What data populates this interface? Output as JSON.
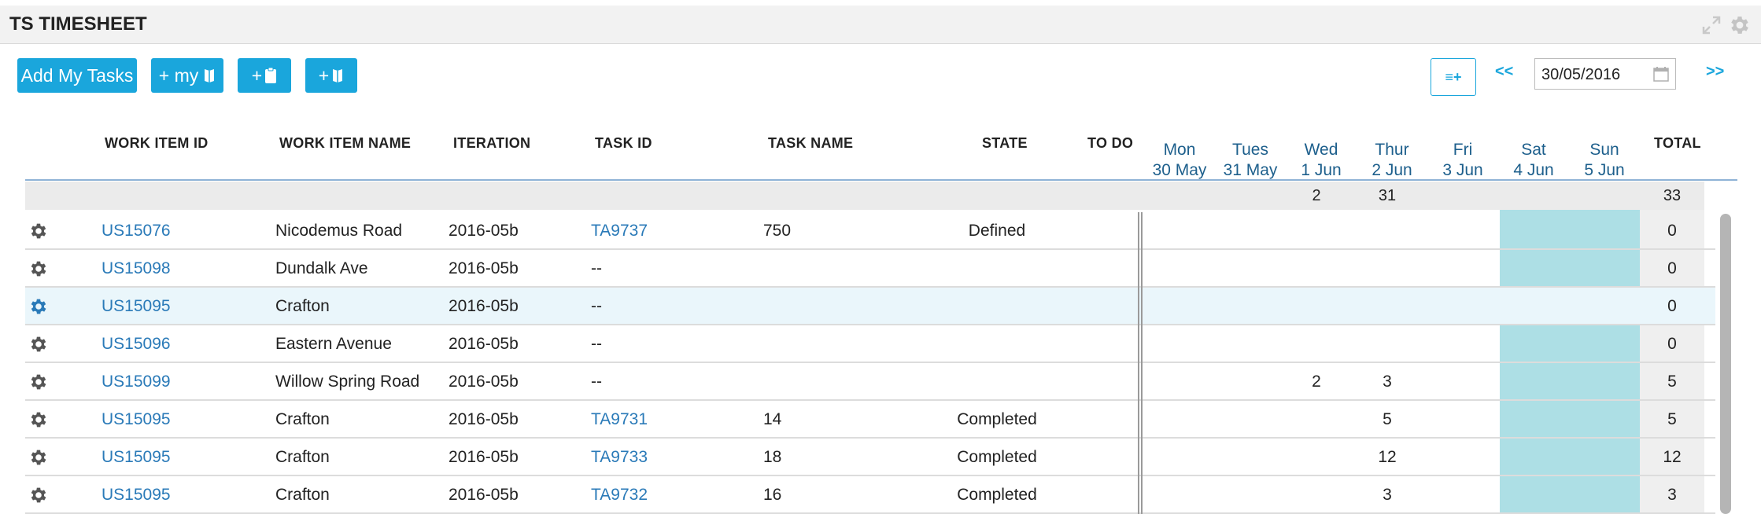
{
  "panel": {
    "title": "TS TIMESHEET",
    "expand_icon": "expand-icon",
    "settings_icon": "gear-icon"
  },
  "toolbar": {
    "add_my_tasks": "Add My Tasks",
    "add_my_stories": "+ my",
    "add_task_icon": "+",
    "add_story_icon": "+",
    "view_toggle": "≡+",
    "prev": "<<",
    "next": ">>",
    "date": "30/05/2016"
  },
  "columns": {
    "work_item_id": "WORK ITEM ID",
    "work_item_name": "WORK ITEM NAME",
    "iteration": "ITERATION",
    "task_id": "TASK ID",
    "task_name": "TASK NAME",
    "state": "STATE",
    "todo": "TO DO",
    "total": "TOTAL"
  },
  "days": [
    {
      "day": "Mon",
      "date": "30 May"
    },
    {
      "day": "Tues",
      "date": "31 May"
    },
    {
      "day": "Wed",
      "date": "1 Jun"
    },
    {
      "day": "Thur",
      "date": "2 Jun"
    },
    {
      "day": "Fri",
      "date": "3 Jun"
    },
    {
      "day": "Sat",
      "date": "4 Jun"
    },
    {
      "day": "Sun",
      "date": "5 Jun"
    }
  ],
  "summary": {
    "wed": "2",
    "thur": "31",
    "total": "33"
  },
  "rows": [
    {
      "work_item_id": "US15076",
      "work_item_name": "Nicodemus Road",
      "iteration": "2016-05b",
      "task_id": "TA9737",
      "task_name": "750",
      "state": "Defined",
      "wed": "",
      "thur": "",
      "total": "0"
    },
    {
      "work_item_id": "US15098",
      "work_item_name": "Dundalk Ave",
      "iteration": "2016-05b",
      "task_id": "--",
      "task_name": "",
      "state": "",
      "wed": "",
      "thur": "",
      "total": "0"
    },
    {
      "work_item_id": "US15095",
      "work_item_name": "Crafton",
      "iteration": "2016-05b",
      "task_id": "--",
      "task_name": "",
      "state": "",
      "wed": "",
      "thur": "",
      "total": "0"
    },
    {
      "work_item_id": "US15096",
      "work_item_name": "Eastern Avenue",
      "iteration": "2016-05b",
      "task_id": "--",
      "task_name": "",
      "state": "",
      "wed": "",
      "thur": "",
      "total": "0"
    },
    {
      "work_item_id": "US15099",
      "work_item_name": "Willow Spring Road",
      "iteration": "2016-05b",
      "task_id": "--",
      "task_name": "",
      "state": "",
      "wed": "2",
      "thur": "3",
      "total": "5"
    },
    {
      "work_item_id": "US15095",
      "work_item_name": "Crafton",
      "iteration": "2016-05b",
      "task_id": "TA9731",
      "task_name": "14",
      "state": "Completed",
      "wed": "",
      "thur": "5",
      "total": "5"
    },
    {
      "work_item_id": "US15095",
      "work_item_name": "Crafton",
      "iteration": "2016-05b",
      "task_id": "TA9733",
      "task_name": "18",
      "state": "Completed",
      "wed": "",
      "thur": "12",
      "total": "12"
    },
    {
      "work_item_id": "US15095",
      "work_item_name": "Crafton",
      "iteration": "2016-05b",
      "task_id": "TA9732",
      "task_name": "16",
      "state": "Completed",
      "wed": "",
      "thur": "3",
      "total": "3"
    }
  ],
  "colors": {
    "accent": "#1aa6dc",
    "link": "#2a7ab8",
    "day_header": "#1d5f8c",
    "weekend": "#addfe5",
    "selected_row": "#eaf6fb"
  }
}
